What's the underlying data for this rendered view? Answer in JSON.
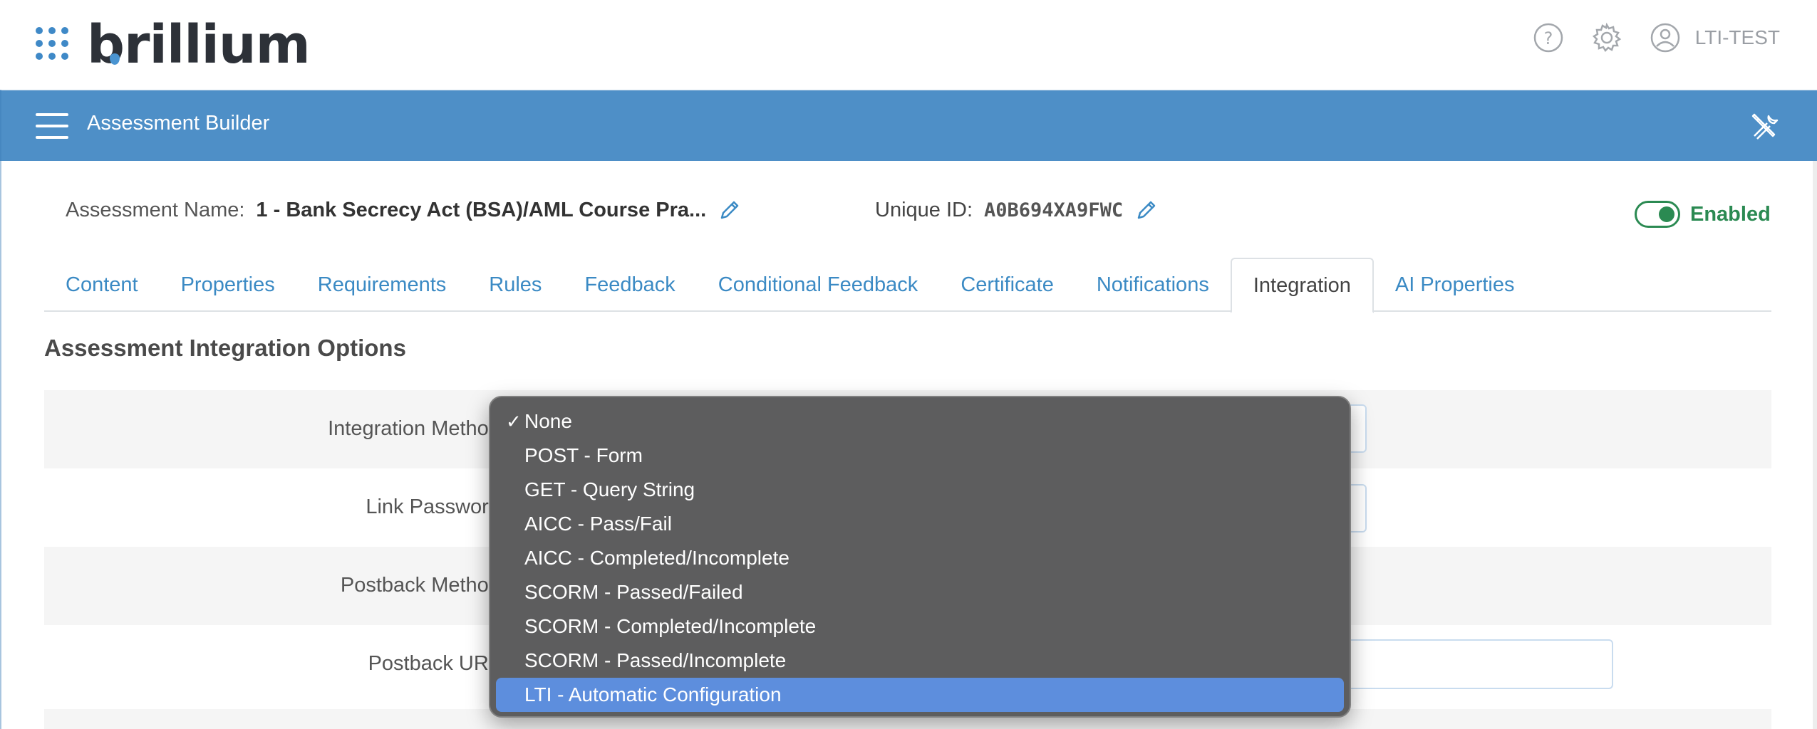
{
  "brand": {
    "logo_text": "brillium",
    "user": "LTI-TEST"
  },
  "appbar": {
    "title": "Assessment Builder"
  },
  "assessment": {
    "name_label": "Assessment Name:",
    "name_value": "1 - Bank Secrecy Act (BSA)/AML Course Pra...",
    "uid_label": "Unique ID:",
    "uid_value": "A0B694XA9FWC",
    "status_label": "Enabled",
    "enabled": true
  },
  "tabs": [
    {
      "label": "Content"
    },
    {
      "label": "Properties"
    },
    {
      "label": "Requirements"
    },
    {
      "label": "Rules"
    },
    {
      "label": "Feedback"
    },
    {
      "label": "Conditional Feedback"
    },
    {
      "label": "Certificate"
    },
    {
      "label": "Notifications"
    },
    {
      "label": "Integration",
      "active": true
    },
    {
      "label": "AI Properties"
    }
  ],
  "section": {
    "title": "Assessment Integration Options"
  },
  "form": {
    "integration_method_label": "Integration Method:",
    "link_password_label": "Link Password:",
    "postback_method_label": "Postback Method:",
    "postback_url_label": "Postback URL:"
  },
  "dropdown": {
    "checked_index": 0,
    "highlighted_index": 8,
    "options": [
      "None",
      "POST - Form",
      "GET - Query String",
      "AICC - Pass/Fail",
      "AICC - Completed/Incomplete",
      "SCORM - Passed/Failed",
      "SCORM - Completed/Incomplete",
      "SCORM - Passed/Incomplete",
      "LTI - Automatic Configuration"
    ],
    "check_glyph": "✓"
  },
  "colors": {
    "brand_blue": "#4e8fc7",
    "link_blue": "#3b8ac4",
    "enabled_green": "#2b8a52",
    "dropdown_bg": "#5d5d5e",
    "dropdown_highlight": "#5d8edd"
  },
  "icons": [
    "app-grid-icon",
    "help-icon",
    "gear-icon",
    "user-icon",
    "hamburger-icon",
    "tools-icon",
    "pencil-icon",
    "check-icon"
  ]
}
